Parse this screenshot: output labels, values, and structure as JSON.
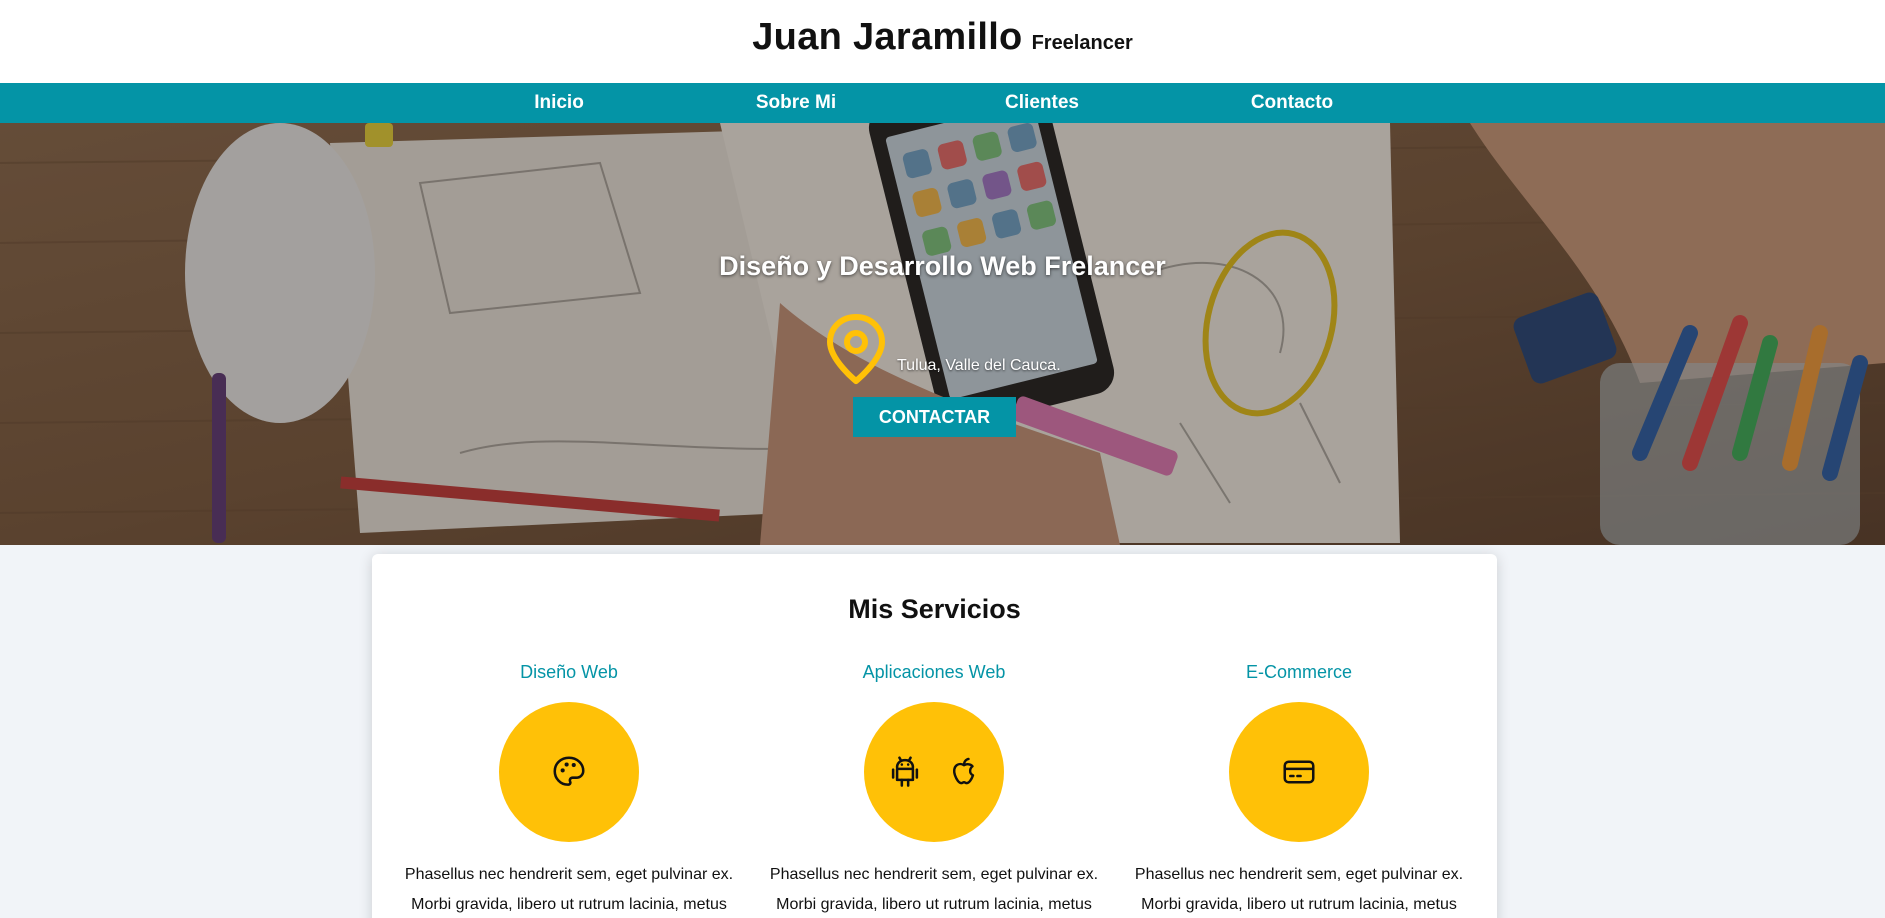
{
  "header": {
    "name": "Juan Jaramillo",
    "tagline": "Freelancer"
  },
  "nav": {
    "items": [
      {
        "label": "Inicio"
      },
      {
        "label": "Sobre Mi"
      },
      {
        "label": "Clientes"
      },
      {
        "label": "Contacto"
      }
    ]
  },
  "hero": {
    "title": "Diseño y Desarrollo Web Frelancer",
    "location_icon": "map-pin-icon",
    "location": "Tulua, Valle del Cauca.",
    "cta": "CONTACTAR"
  },
  "services": {
    "title": "Mis Servicios",
    "items": [
      {
        "name": "Diseño Web",
        "icons": [
          "palette-icon"
        ],
        "description": "Phasellus nec hendrerit sem, eget pulvinar ex. Morbi gravida, libero ut rutrum lacinia, metus"
      },
      {
        "name": "Aplicaciones Web",
        "icons": [
          "android-icon",
          "apple-icon"
        ],
        "description": "Phasellus nec hendrerit sem, eget pulvinar ex. Morbi gravida, libero ut rutrum lacinia, metus"
      },
      {
        "name": "E-Commerce",
        "icons": [
          "credit-card-icon"
        ],
        "description": "Phasellus nec hendrerit sem, eget pulvinar ex. Morbi gravida, libero ut rutrum lacinia, metus"
      }
    ]
  },
  "colors": {
    "accent": "#0494a6",
    "highlight": "#ffc107",
    "background": "#f1f4f8"
  }
}
